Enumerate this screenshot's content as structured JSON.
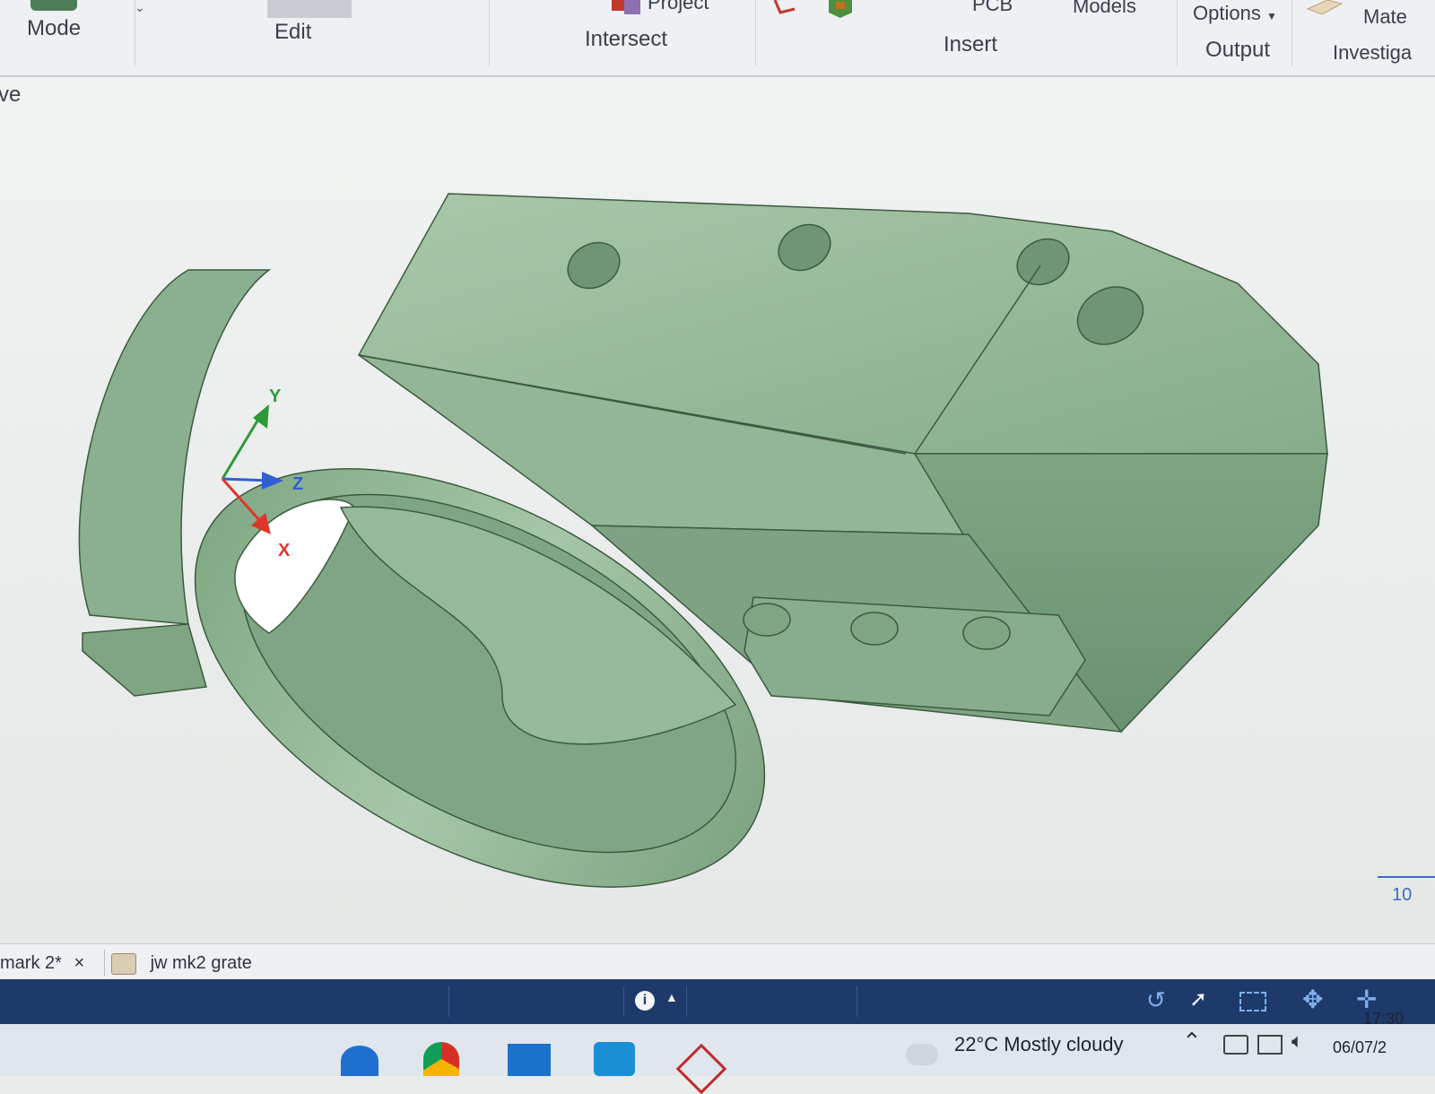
{
  "ribbon": {
    "groups": {
      "mode": "Mode",
      "edit": "Edit",
      "intersect": "Intersect",
      "insert": "Insert",
      "output": "Output",
      "investigate": "Investiga"
    },
    "items": {
      "project": "Project",
      "pcb": "PCB",
      "models": "Models",
      "options": "Options",
      "materials": "Mate"
    }
  },
  "viewport": {
    "left_label": "ve",
    "axes": {
      "x": "X",
      "y": "Y",
      "z": "Z"
    },
    "scale_label": "10",
    "model_color": "#8fb693"
  },
  "document_tabs": [
    {
      "label": "mark 2*",
      "close": "×"
    },
    {
      "label": "jw mk2 grate"
    }
  ],
  "taskbar": {
    "weather": "22°C  Mostly cloudy",
    "time": "17:30",
    "date": "06/07/2"
  },
  "colors": {
    "status_bar": "#1e3a6b",
    "axis_x": "#e0352b",
    "axis_y": "#2e9a3a",
    "axis_z": "#2f5fd3"
  }
}
